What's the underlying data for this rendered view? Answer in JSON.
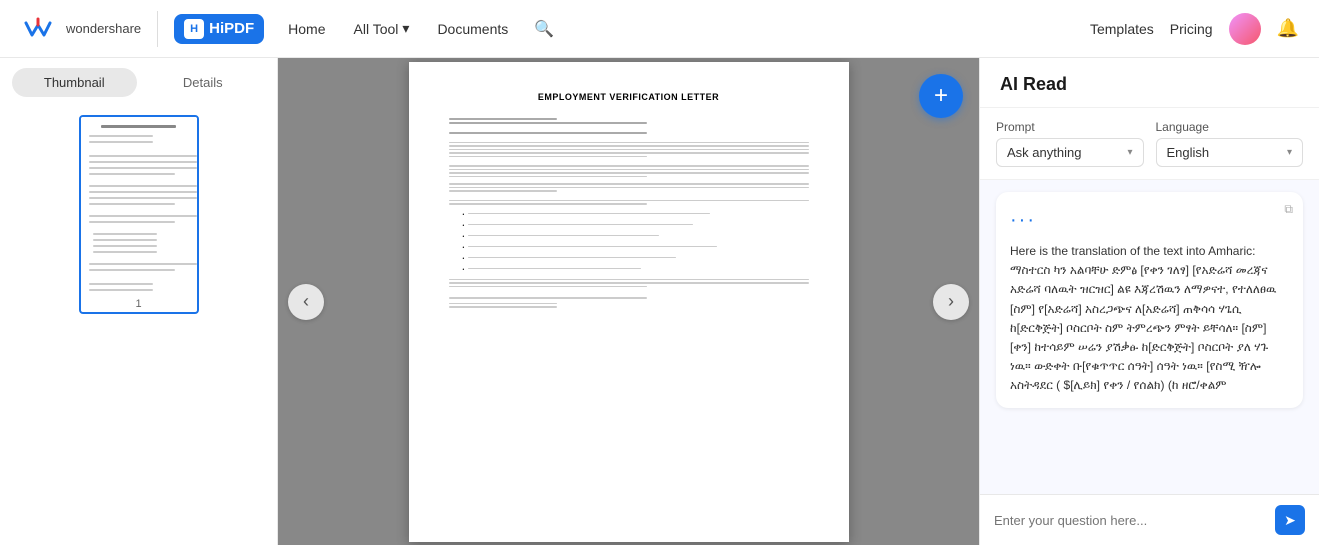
{
  "header": {
    "logo_text": "wondershare",
    "hipdf_label": "HiPDF",
    "nav": {
      "home": "Home",
      "all_tool": "All Tool",
      "documents": "Documents",
      "templates": "Templates",
      "pricing": "Pricing"
    }
  },
  "sidebar": {
    "tab_thumbnail": "Thumbnail",
    "tab_details": "Details",
    "page_number": "1"
  },
  "document": {
    "title": "EMPLOYMENT VERIFICATION LETTER",
    "nav_left": "‹",
    "nav_right": "›",
    "fab_icon": "+"
  },
  "ai_panel": {
    "title": "AI Read",
    "prompt_label": "Prompt",
    "language_label": "Language",
    "prompt_placeholder": "Ask anything",
    "language_value": "English",
    "chat_content": "Here is the translation of the text into Amharic: ማስተርስ ካን አልባቸሁ ድምፅ [የቀን ገለፃ] [የአድሬሻ መረጃና አድሬሻ ባለዉት ዝርዝር] ልዩ እጃረሽዉን ለማዎናተ, የተለለፀዉ [ስም] የ[አድሬሻ] አስረጋጭና ለ[አድሬሻ] ጠቅሳሳ ሃጌሲ ከ[ድርቅጅት] ቦስርቦት ስም ትምረጭን ምፃት ይቸሳለ። [ስም] [ቀን] ከተሳይም ሠሬን ያሽቃፁ ከ[ድርቅጅት] ቦስርቦት ያለ ሃጉ ነዉ። ውድቀት ቡ[የቁጥጥር ሰዓት] ሰዓት ነዉ። [የስሚ ዥሎ አስትዳደር ( $[ሊይክ] የቀን / የሰልክ) (ከ ዘሮ/ቀልም",
    "input_placeholder": "Enter your question here..."
  }
}
